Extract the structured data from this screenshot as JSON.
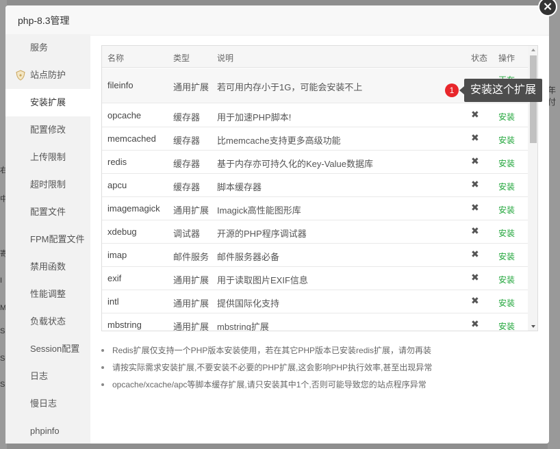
{
  "window": {
    "title": "php-8.3管理",
    "close_glyph": "×"
  },
  "background": {
    "left_fragments": [
      "右",
      "中",
      "寄",
      "I",
      "M",
      "S",
      "Se",
      "S"
    ],
    "right_fragment": "年付"
  },
  "sidebar": {
    "items": [
      {
        "label": "服务",
        "active": false
      },
      {
        "label": "站点防护",
        "active": false,
        "icon": "shield-icon"
      },
      {
        "label": "安装扩展",
        "active": true
      },
      {
        "label": "配置修改",
        "active": false
      },
      {
        "label": "上传限制",
        "active": false
      },
      {
        "label": "超时限制",
        "active": false
      },
      {
        "label": "配置文件",
        "active": false
      },
      {
        "label": "FPM配置文件",
        "active": false
      },
      {
        "label": "禁用函数",
        "active": false
      },
      {
        "label": "性能调整",
        "active": false
      },
      {
        "label": "负载状态",
        "active": false
      },
      {
        "label": "Session配置",
        "active": false
      },
      {
        "label": "日志",
        "active": false
      },
      {
        "label": "慢日志",
        "active": false
      },
      {
        "label": "phpinfo",
        "active": false
      }
    ]
  },
  "table": {
    "headers": {
      "name": "名称",
      "type": "类型",
      "desc": "说明",
      "status": "状态",
      "op": "操作"
    },
    "rows": [
      {
        "name": "fileinfo",
        "type": "通用扩展",
        "desc": "若可用内存小于1G，可能会安装不上",
        "status": "✖",
        "op": "正在"
      },
      {
        "name": "opcache",
        "type": "缓存器",
        "desc": "用于加速PHP脚本!",
        "status": "✖",
        "op": "安装"
      },
      {
        "name": "memcached",
        "type": "缓存器",
        "desc": "比memcache支持更多高级功能",
        "status": "✖",
        "op": "安装"
      },
      {
        "name": "redis",
        "type": "缓存器",
        "desc": "基于内存亦可持久化的Key-Value数据库",
        "status": "✖",
        "op": "安装"
      },
      {
        "name": "apcu",
        "type": "缓存器",
        "desc": "脚本缓存器",
        "status": "✖",
        "op": "安装"
      },
      {
        "name": "imagemagick",
        "type": "通用扩展",
        "desc": "Imagick高性能图形库",
        "status": "✖",
        "op": "安装"
      },
      {
        "name": "xdebug",
        "type": "调试器",
        "desc": "开源的PHP程序调试器",
        "status": "✖",
        "op": "安装"
      },
      {
        "name": "imap",
        "type": "邮件服务",
        "desc": "邮件服务器必备",
        "status": "✖",
        "op": "安装"
      },
      {
        "name": "exif",
        "type": "通用扩展",
        "desc": "用于读取图片EXIF信息",
        "status": "✖",
        "op": "安装"
      },
      {
        "name": "intl",
        "type": "通用扩展",
        "desc": "提供国际化支持",
        "status": "✖",
        "op": "安装"
      },
      {
        "name": "mbstring",
        "type": "通用扩展",
        "desc": "mbstring扩展",
        "status": "✖",
        "op": "安装"
      }
    ]
  },
  "tooltip": {
    "step": "1",
    "text": "安装这个扩展"
  },
  "tips": [
    "Redis扩展仅支持一个PHP版本安装使用，若在其它PHP版本已安装redis扩展，请勿再装",
    "请按实际需求安装扩展,不要安装不必要的PHP扩展,这会影响PHP执行效率,甚至出现异常",
    "opcache/xcache/apc等脚本缓存扩展,请只安装其中1个,否则可能导致您的站点程序异常"
  ],
  "colors": {
    "install_link": "#20a53a",
    "badge": "#e8262b",
    "tooltip_bg": "#4d4d4d"
  }
}
